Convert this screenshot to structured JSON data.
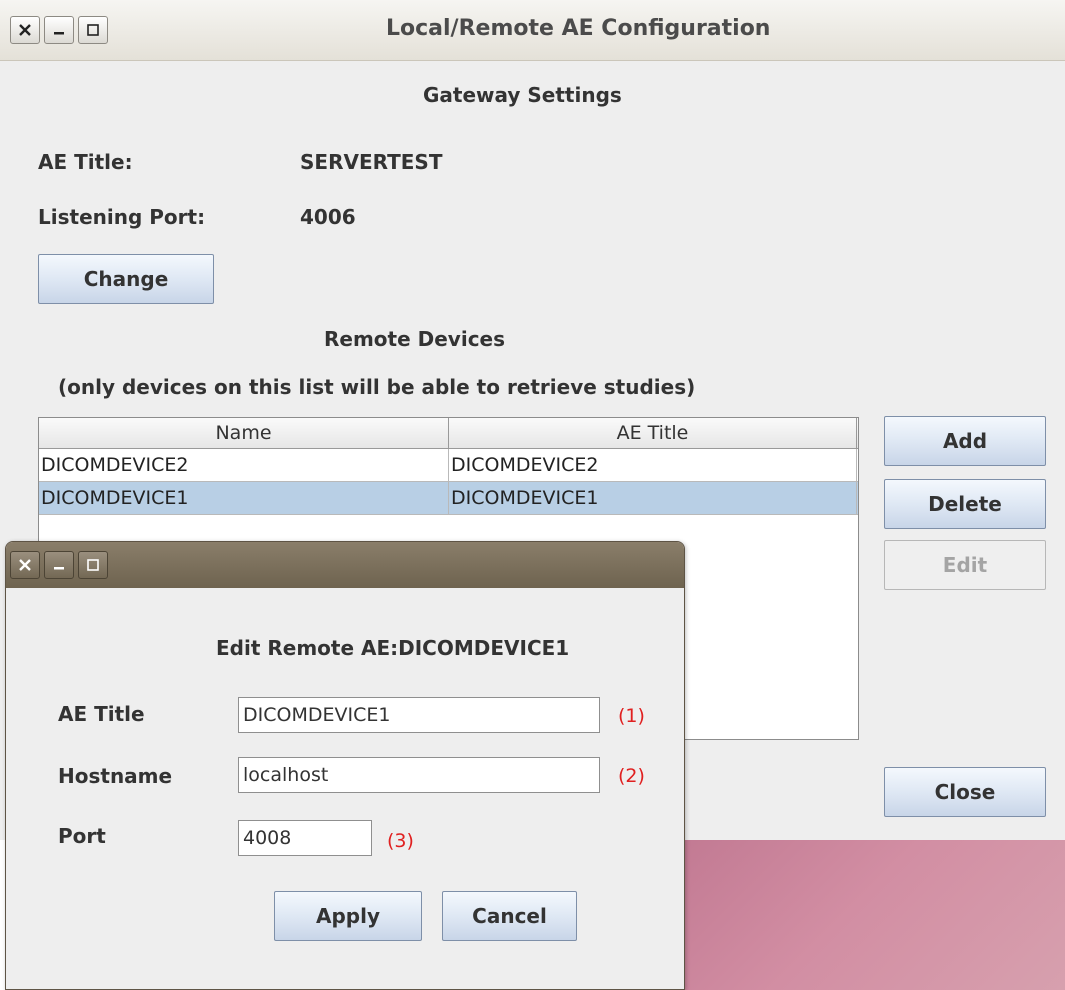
{
  "main_window": {
    "title": "Local/Remote AE Configuration",
    "gateway_heading": "Gateway Settings",
    "ae_title_label": "AE Title:",
    "ae_title_value": "SERVERTEST",
    "port_label": "Listening Port:",
    "port_value": "4006",
    "change_label": "Change",
    "remote_heading": "Remote Devices",
    "remote_note": "(only devices on this list will be able to retrieve studies)",
    "table": {
      "columns": [
        "Name",
        "AE Title"
      ],
      "rows": [
        {
          "name": "DICOMDEVICE2",
          "ae_title": "DICOMDEVICE2",
          "selected": false
        },
        {
          "name": "DICOMDEVICE1",
          "ae_title": "DICOMDEVICE1",
          "selected": true
        }
      ]
    },
    "add_label": "Add",
    "delete_label": "Delete",
    "edit_label": "Edit",
    "close_label": "Close"
  },
  "dialog": {
    "heading": "Edit Remote AE:DICOMDEVICE1",
    "ae_title_label": "AE Title",
    "ae_title_value": "DICOMDEVICE1",
    "hostname_label": "Hostname",
    "hostname_value": "localhost",
    "port_label": "Port",
    "port_value": "4008",
    "marker_1": "(1)",
    "marker_2": "(2)",
    "marker_3": "(3)",
    "apply_label": "Apply",
    "cancel_label": "Cancel"
  },
  "colors": {
    "selected_row": "#b8cfe5",
    "marker_red": "#e02020",
    "dialog_titlebar": "#7a6f5c",
    "desktop": "#c9849a"
  },
  "icons": [
    "close-icon",
    "minimize-icon",
    "maximize-icon"
  ]
}
